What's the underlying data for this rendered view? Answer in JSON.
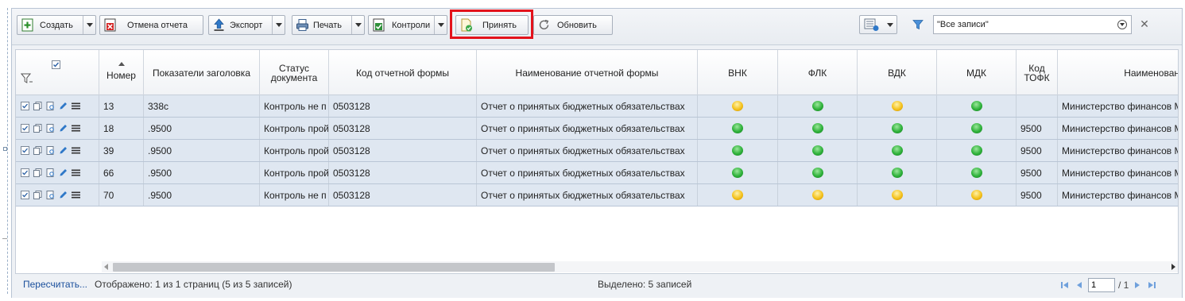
{
  "toolbar": {
    "create_label": "Создать",
    "cancel_report_label": "Отмена отчета",
    "export_label": "Экспорт",
    "print_label": "Печать",
    "controls_label": "Контроли",
    "accept_label": "Принять",
    "refresh_label": "Обновить",
    "filter_value": "\"Все записи\""
  },
  "grid": {
    "headers": {
      "number": "Номер",
      "header_indicators": "Показатели заголовка",
      "doc_status": "Статус документа",
      "form_code": "Код отчетной формы",
      "form_name": "Наименование отчетной формы",
      "vnk": "ВНК",
      "flk": "ФЛК",
      "vdk": "ВДК",
      "mdk": "МДК",
      "tofk_code": "Код ТОФК",
      "name": "Наименован"
    },
    "rows": [
      {
        "number": "13",
        "indicators": "338с",
        "status": "Контроль не п",
        "form_code": "0503128",
        "form_name": "Отчет о принятых бюджетных обязательствах",
        "vnk": "yellow",
        "flk": "green",
        "vdk": "yellow",
        "mdk": "green",
        "tofk": "",
        "name": "Министерство финансов М"
      },
      {
        "number": "18",
        "indicators": ".9500",
        "status": "Контроль прой",
        "form_code": "0503128",
        "form_name": "Отчет о принятых бюджетных обязательствах",
        "vnk": "green",
        "flk": "green",
        "vdk": "green",
        "mdk": "green",
        "tofk": "9500",
        "name": "Министерство финансов М"
      },
      {
        "number": "39",
        "indicators": ".9500",
        "status": "Контроль прой",
        "form_code": "0503128",
        "form_name": "Отчет о принятых бюджетных обязательствах",
        "vnk": "green",
        "flk": "green",
        "vdk": "green",
        "mdk": "green",
        "tofk": "9500",
        "name": "Министерство финансов М"
      },
      {
        "number": "66",
        "indicators": ".9500",
        "status": "Контроль прой",
        "form_code": "0503128",
        "form_name": "Отчет о принятых бюджетных обязательствах",
        "vnk": "green",
        "flk": "green",
        "vdk": "green",
        "mdk": "green",
        "tofk": "9500",
        "name": "Министерство финансов М"
      },
      {
        "number": "70",
        "indicators": ".9500",
        "status": "Контроль не п",
        "form_code": "0503128",
        "form_name": "Отчет о принятых бюджетных обязательствах",
        "vnk": "yellow",
        "flk": "yellow",
        "vdk": "yellow",
        "mdk": "yellow",
        "tofk": "9500",
        "name": "Министерство финансов М"
      }
    ]
  },
  "status": {
    "recalc_label": "Пересчитать...",
    "shown_text": "Отображено: 1 из 1 страниц (5 из 5 записей)",
    "selected_text": "Выделено: 5 записей",
    "page_value": "1",
    "page_total": "/ 1"
  },
  "colors": {
    "highlight": "#e3121b",
    "row_bg": "#dfe7f1",
    "link": "#1a4f9c"
  },
  "icons": {
    "create": "add-document-icon",
    "cancel_report": "cancel-report-icon",
    "export": "upload-arrow-icon",
    "print": "printer-icon",
    "controls": "checklist-icon",
    "accept": "accept-document-icon",
    "refresh": "refresh-icon",
    "columns": "column-settings-icon",
    "filter": "filter-funnel-icon",
    "clear": "close-icon"
  }
}
